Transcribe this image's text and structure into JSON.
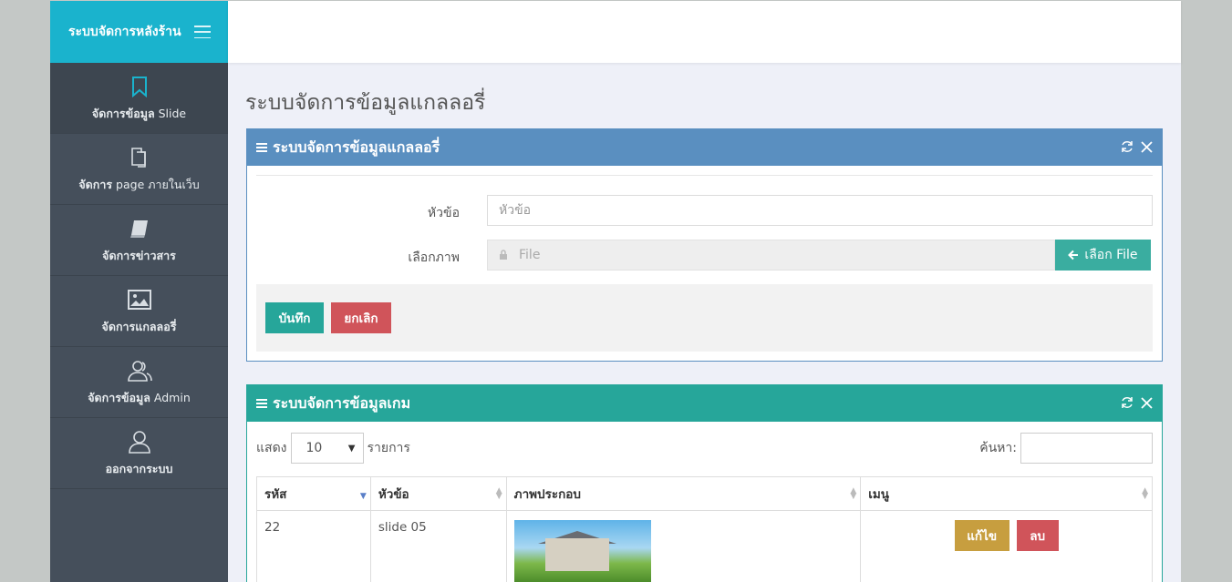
{
  "sidebar": {
    "brand": "ระบบจัดการหลังร้าน",
    "items": [
      {
        "label_bold": "จัดการข้อมูล",
        "label_rest": " Slide",
        "icon": "bookmark-icon"
      },
      {
        "label_bold": "จัดการ",
        "label_rest": " page ภายในเว็บ",
        "icon": "copy-icon"
      },
      {
        "label_bold": "จัดการข่าวสาร",
        "label_rest": "",
        "icon": "book-icon"
      },
      {
        "label_bold": "จัดการแกลลอรี่",
        "label_rest": "",
        "icon": "image-icon"
      },
      {
        "label_bold": "จัดการข้อมูล",
        "label_rest": " Admin",
        "icon": "users-icon"
      },
      {
        "label_bold": "ออกจากระบบ",
        "label_rest": "",
        "icon": "user-icon"
      }
    ]
  },
  "main": {
    "page_title": "ระบบจัดการข้อมูลแกลลอรี่",
    "form_panel": {
      "title": "ระบบจัดการข้อมูลแกลลอรี่",
      "title_label": "หัวข้อ",
      "title_placeholder": "หัวข้อ",
      "image_label": "เลือกภาพ",
      "file_placeholder": "File",
      "file_button": "เลือก File",
      "save_button": "บันทึก",
      "cancel_button": "ยกเลิก"
    },
    "table_panel": {
      "title": "ระบบจัดการข้อมูลเกม",
      "show_label": "แสดง",
      "page_length": "10",
      "entries_label": "รายการ",
      "search_label": "ค้นหา:",
      "columns": [
        "รหัส",
        "หัวข้อ",
        "ภาพประกอบ",
        "เมนู"
      ],
      "rows": [
        {
          "id": "22",
          "title": "slide 05",
          "edit": "แก้ไข",
          "delete": "ลบ"
        }
      ]
    }
  },
  "colors": {
    "brand": "#1ab3cd",
    "panel_blue": "#5a8fc0",
    "panel_teal": "#26a69a",
    "danger": "#d0545a",
    "warning": "#c79e3f"
  }
}
